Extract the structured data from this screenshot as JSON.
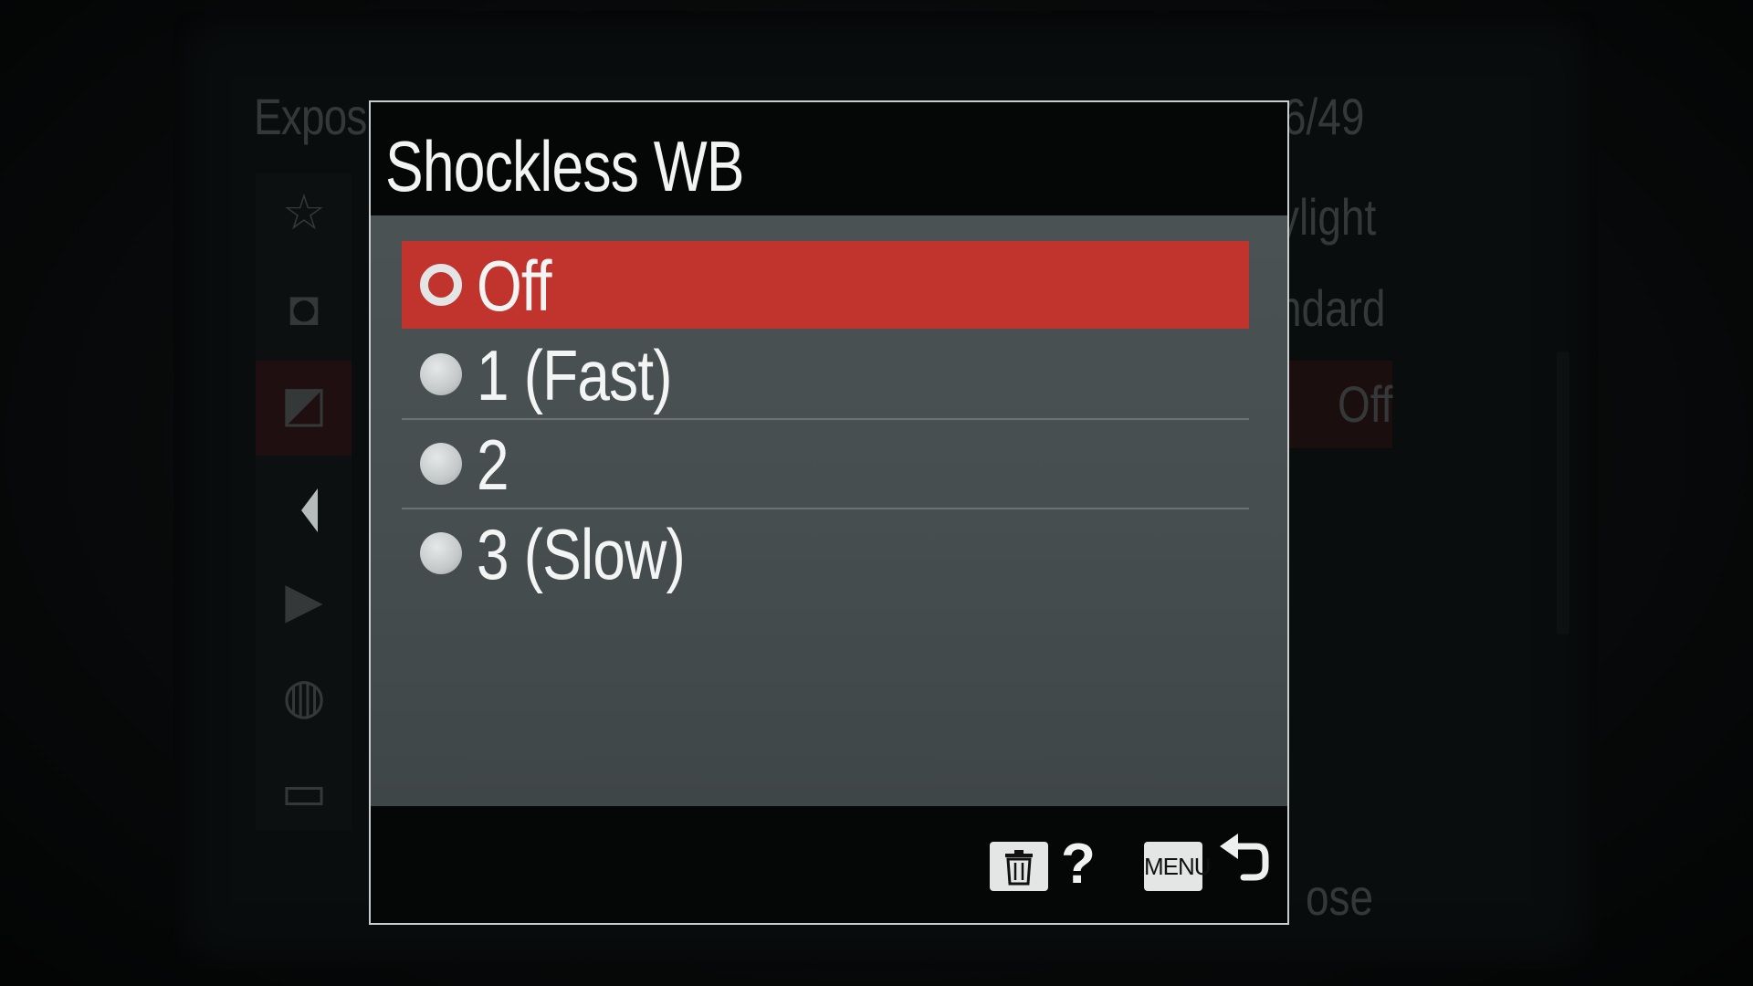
{
  "background_menu": {
    "title": "Expos",
    "page_indicator": "6/49",
    "values": [
      "ylight",
      "ndard",
      "Off"
    ],
    "footer_fragment": "ose"
  },
  "dialog": {
    "title": "Shockless WB",
    "options": [
      {
        "label": "Off",
        "selected": true
      },
      {
        "label": "1 (Fast)",
        "selected": false
      },
      {
        "label": "2",
        "selected": false
      },
      {
        "label": "3 (Slow)",
        "selected": false
      }
    ],
    "footer": {
      "help_label": "?",
      "menu_key_label": "MENU"
    }
  },
  "colors": {
    "selection": "#c1332d",
    "body": "#4a5254",
    "header": "#050707"
  },
  "icons": {
    "sidebar": [
      "star-icon",
      "camera-icon",
      "exposure-icon",
      "play-icon",
      "globe-icon",
      "toolbox-icon"
    ],
    "footer": [
      "trash-icon",
      "help-icon",
      "return-icon"
    ]
  }
}
